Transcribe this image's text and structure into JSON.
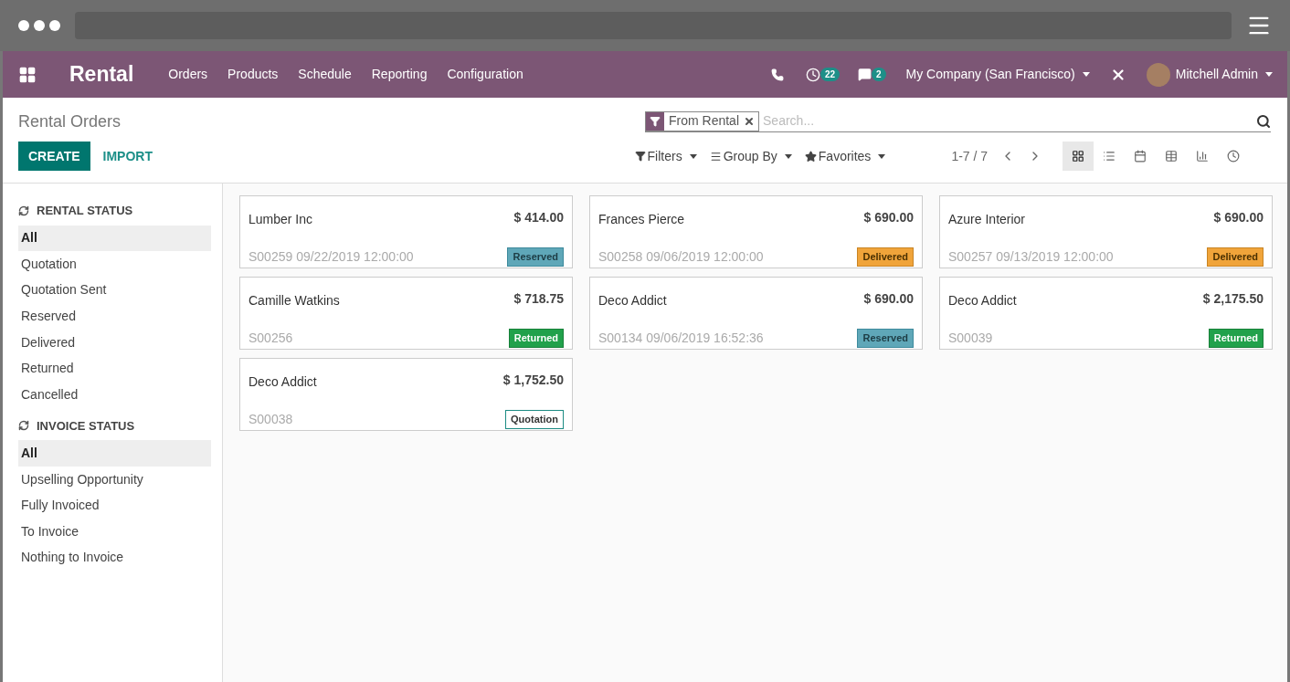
{
  "app": {
    "name": "Rental",
    "menu": [
      "Orders",
      "Products",
      "Schedule",
      "Reporting",
      "Configuration"
    ],
    "activity_count": "22",
    "message_count": "2",
    "company": "My Company (San Francisco)",
    "user": "Mitchell Admin"
  },
  "control_panel": {
    "title": "Rental Orders",
    "create": "CREATE",
    "import": "IMPORT",
    "facet": "From Rental",
    "search_placeholder": "Search...",
    "filters": "Filters",
    "group_by": "Group By",
    "favorites": "Favorites",
    "pager": "1-7 / 7",
    "views": [
      {
        "kind": "kanban",
        "selected": true
      },
      {
        "kind": "list",
        "selected": false
      },
      {
        "kind": "calendar",
        "selected": false
      },
      {
        "kind": "pivot",
        "selected": false
      },
      {
        "kind": "graph",
        "selected": false
      },
      {
        "kind": "activity",
        "selected": false
      }
    ]
  },
  "sidebar": [
    {
      "title": "RENTAL STATUS",
      "items": [
        {
          "label": "All",
          "selected": true
        },
        {
          "label": "Quotation",
          "selected": false
        },
        {
          "label": "Quotation Sent",
          "selected": false
        },
        {
          "label": "Reserved",
          "selected": false
        },
        {
          "label": "Delivered",
          "selected": false
        },
        {
          "label": "Returned",
          "selected": false
        },
        {
          "label": "Cancelled",
          "selected": false
        }
      ]
    },
    {
      "title": "INVOICE STATUS",
      "items": [
        {
          "label": "All",
          "selected": true
        },
        {
          "label": "Upselling Opportunity",
          "selected": false
        },
        {
          "label": "Fully Invoiced",
          "selected": false
        },
        {
          "label": "To Invoice",
          "selected": false
        },
        {
          "label": "Nothing to Invoice",
          "selected": false
        }
      ]
    }
  ],
  "cards": [
    {
      "customer": "Lumber Inc",
      "amount": "$ 414.00",
      "reference": "S00259 09/22/2019 12:00:00",
      "status": {
        "label": "Reserved",
        "kind": "reserved"
      }
    },
    {
      "customer": "Frances Pierce",
      "amount": "$ 690.00",
      "reference": "S00258 09/06/2019 12:00:00",
      "status": {
        "label": "Delivered",
        "kind": "delivered"
      }
    },
    {
      "customer": "Azure Interior",
      "amount": "$ 690.00",
      "reference": "S00257 09/13/2019 12:00:00",
      "status": {
        "label": "Delivered",
        "kind": "delivered"
      }
    },
    {
      "customer": "Camille Watkins",
      "amount": "$ 718.75",
      "reference": "S00256",
      "status": {
        "label": "Returned",
        "kind": "returned"
      }
    },
    {
      "customer": "Deco Addict",
      "amount": "$ 690.00",
      "reference": "S00134 09/06/2019 16:52:36",
      "status": {
        "label": "Reserved",
        "kind": "reserved"
      }
    },
    {
      "customer": "Deco Addict",
      "amount": "$ 2,175.50",
      "reference": "S00039",
      "status": {
        "label": "Returned",
        "kind": "returned"
      }
    },
    {
      "customer": "Deco Addict",
      "amount": "$ 1,752.50",
      "reference": "S00038",
      "status": {
        "label": "Quotation",
        "kind": "quotation"
      }
    }
  ]
}
